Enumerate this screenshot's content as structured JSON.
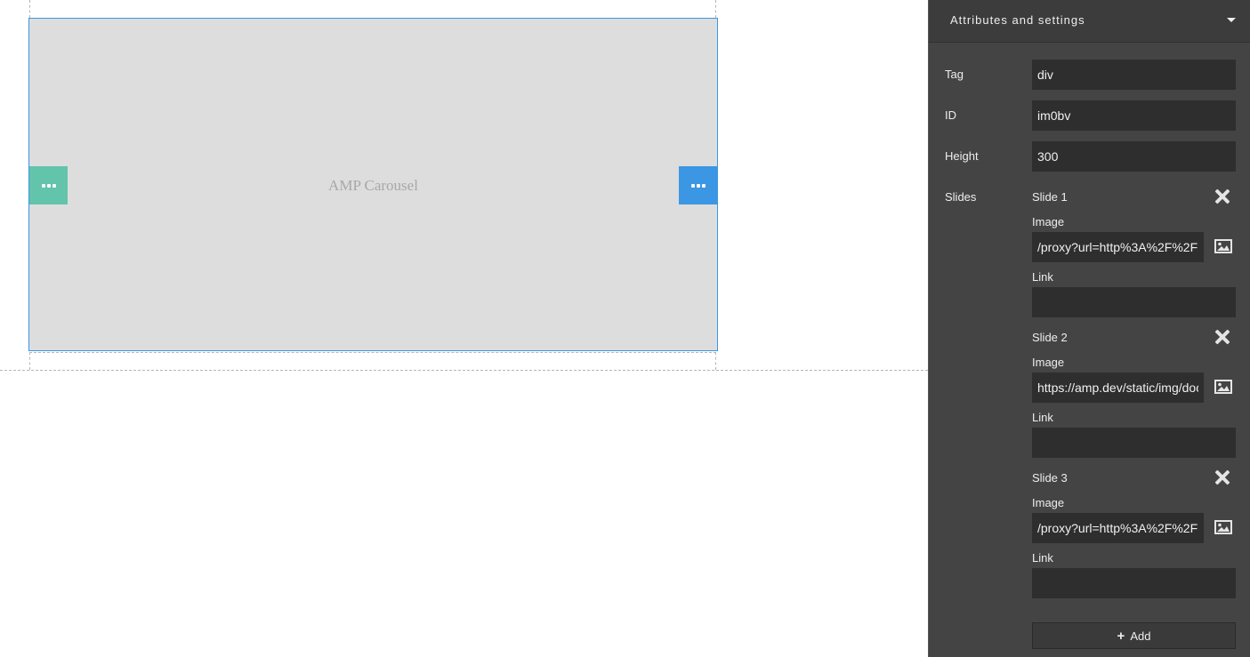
{
  "canvas": {
    "carousel_label": "AMP Carousel"
  },
  "panel": {
    "title": "Attributes and settings",
    "traits": {
      "tag": {
        "label": "Tag",
        "value": "div"
      },
      "id": {
        "label": "ID",
        "value": "im0bv"
      },
      "height": {
        "label": "Height",
        "value": "300"
      },
      "slides_label": "Slides"
    },
    "slides": [
      {
        "title": "Slide 1",
        "image_label": "Image",
        "image_value": "/proxy?url=http%3A%2F%2F",
        "link_label": "Link",
        "link_value": ""
      },
      {
        "title": "Slide 2",
        "image_label": "Image",
        "image_value": "https://amp.dev/static/img/doc",
        "link_label": "Link",
        "link_value": ""
      },
      {
        "title": "Slide 3",
        "image_label": "Image",
        "image_value": "/proxy?url=http%3A%2F%2F",
        "link_label": "Link",
        "link_value": ""
      }
    ],
    "add_label": "Add"
  },
  "colors": {
    "accent_blue": "#3b97e3",
    "accent_green": "#62c4aa",
    "panel_bg": "#444444",
    "field_bg": "#2e2e2e"
  },
  "icons": [
    "caret-down-icon",
    "more-dots-icon",
    "close-icon",
    "image-icon",
    "plus-icon"
  ]
}
